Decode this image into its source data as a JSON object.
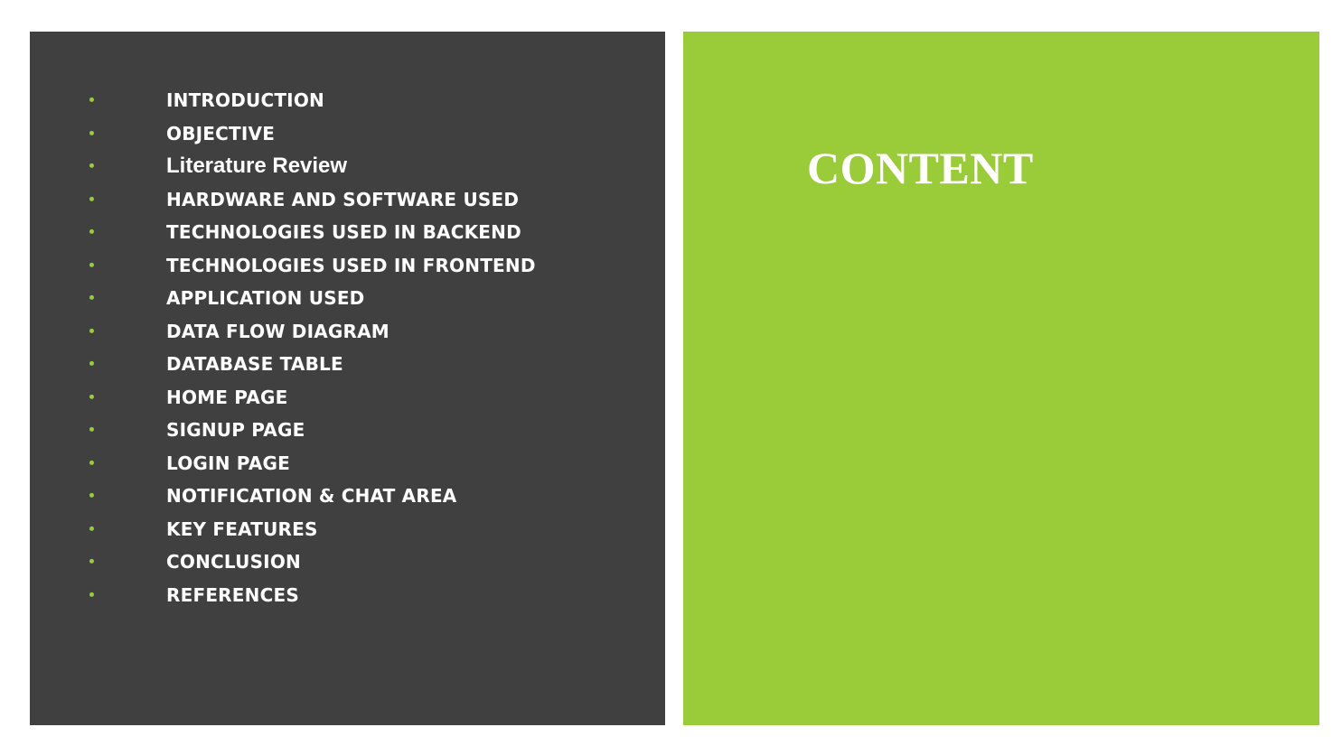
{
  "slide": {
    "title": "CONTENT",
    "colors": {
      "left_panel": "#404040",
      "right_panel": "#9acb38",
      "bullet": "#9acb38",
      "text": "#ffffff"
    },
    "items": [
      {
        "label": "INTRODUCTION"
      },
      {
        "label": "OBJECTIVE"
      },
      {
        "label": "Literature Review"
      },
      {
        "label": "HARDWARE AND SOFTWARE USED"
      },
      {
        "label": "TECHNOLOGIES USED IN BACKEND"
      },
      {
        "label": "TECHNOLOGIES USED IN FRONTEND"
      },
      {
        "label": "APPLICATION USED"
      },
      {
        "label": "DATA FLOW DIAGRAM"
      },
      {
        "label": "DATABASE TABLE"
      },
      {
        "label": "HOME PAGE"
      },
      {
        "label": "SIGNUP PAGE"
      },
      {
        "label": "LOGIN PAGE"
      },
      {
        "label": "NOTIFICATION & CHAT AREA"
      },
      {
        "label": "KEY FEATURES"
      },
      {
        "label": "CONCLUSION"
      },
      {
        "label": "REFERENCES"
      }
    ]
  }
}
